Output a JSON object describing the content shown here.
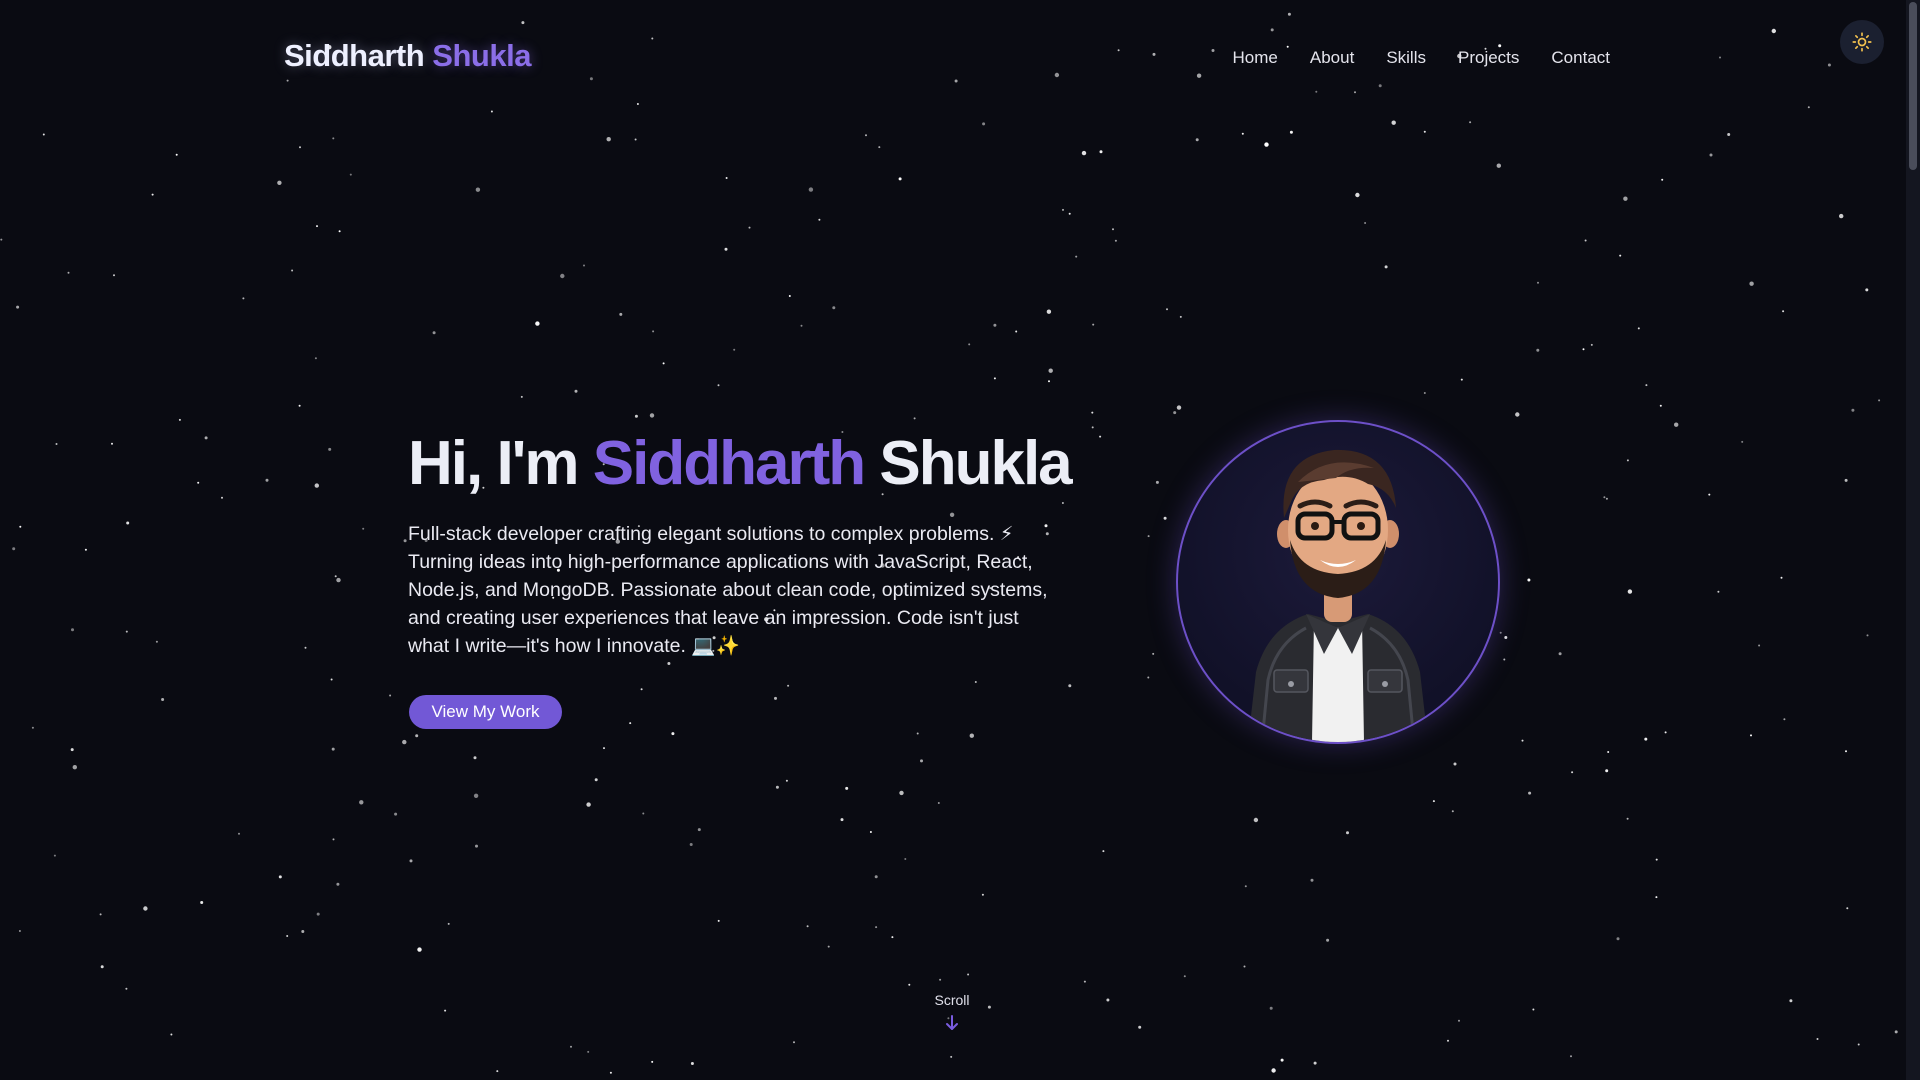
{
  "header": {
    "logo_first": "Siddharth",
    "logo_last": "Shukla",
    "nav": [
      {
        "label": "Home"
      },
      {
        "label": "About"
      },
      {
        "label": "Skills"
      },
      {
        "label": "Projects"
      },
      {
        "label": "Contact"
      }
    ],
    "theme_icon": "sun-icon"
  },
  "hero": {
    "greeting": "Hi, I'm",
    "first_name": "Siddharth",
    "last_name": "Shukla",
    "description": "Full-stack developer crafting elegant solutions to complex problems. ⚡ Turning ideas into high-performance applications with JavaScript, React, Node.js, and MongoDB. Passionate about clean code, optimized systems, and creating user experiences that leave an impression. Code isn't just what I write—it's how I innovate. 💻✨",
    "cta_label": "View My Work",
    "avatar_icon": "developer-avatar-illustration"
  },
  "scroll": {
    "label": "Scroll",
    "icon": "arrow-down-icon"
  },
  "colors": {
    "background": "#0a0b12",
    "accent": "#8062e0",
    "button": "#7258d6",
    "text": "#eceef6"
  }
}
